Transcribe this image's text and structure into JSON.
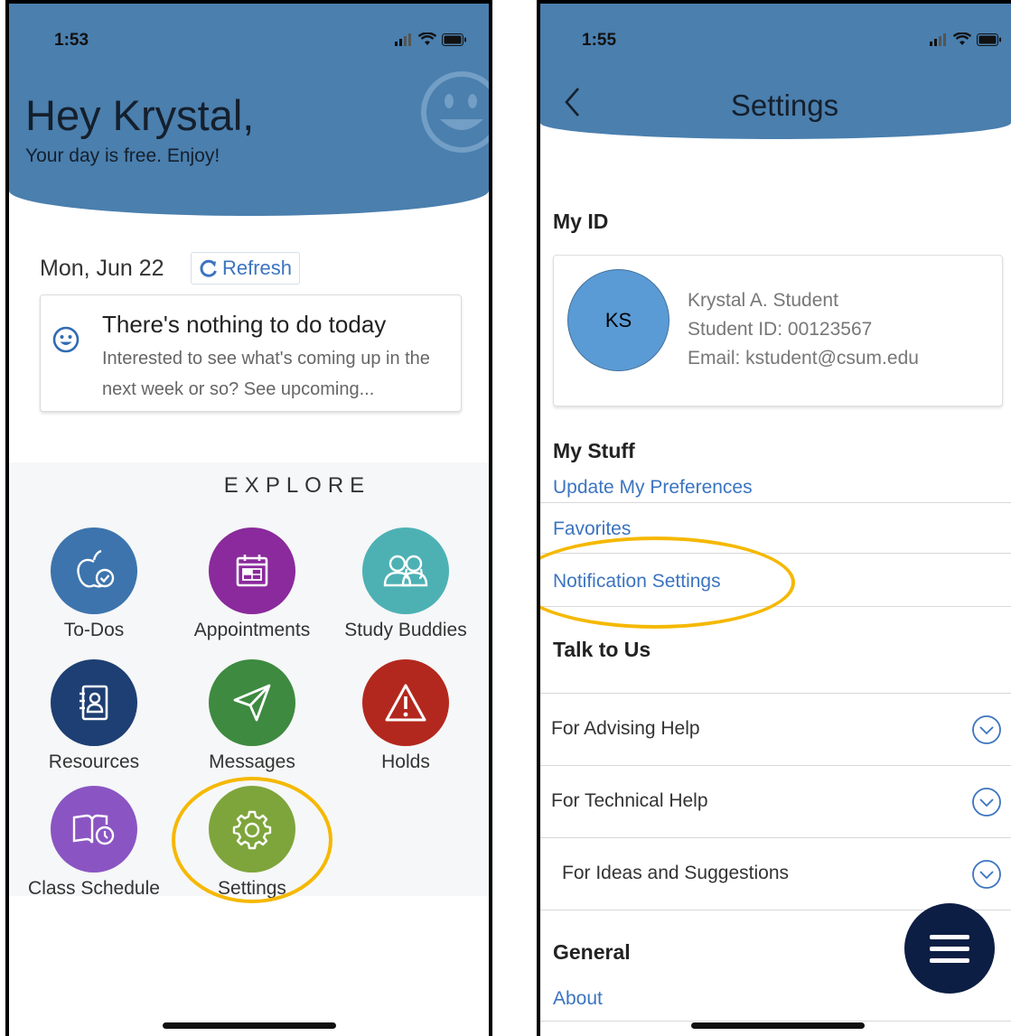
{
  "colors": {
    "header": "#4a7fae",
    "link": "#3b74c0",
    "highlight": "#f5b800",
    "fab": "#0d1e44"
  },
  "home": {
    "time": "1:53",
    "greeting": "Hey Krystal,",
    "subtitle": "Your day is free. Enjoy!",
    "date": "Mon, Jun 22",
    "refresh_label": "Refresh",
    "empty_title": "There's nothing to do today",
    "empty_body": "Interested to see what's coming up in the next week or so? See upcoming...",
    "explore_label": "EXPLORE",
    "tiles": [
      {
        "label": "To-Dos",
        "color": "#3d74ad",
        "icon": "apple-check-icon"
      },
      {
        "label": "Appointments",
        "color": "#8a2a9c",
        "icon": "calendar-icon"
      },
      {
        "label": "Study Buddies",
        "color": "#4db1b4",
        "icon": "people-icon"
      },
      {
        "label": "Resources",
        "color": "#1d3f73",
        "icon": "address-book-icon"
      },
      {
        "label": "Messages",
        "color": "#3e8a40",
        "icon": "paper-plane-icon"
      },
      {
        "label": "Holds",
        "color": "#b3281e",
        "icon": "warning-icon"
      },
      {
        "label": "Class Schedule",
        "color": "#8a55c3",
        "icon": "book-clock-icon"
      },
      {
        "label": "Settings",
        "color": "#7ea53b",
        "icon": "gear-icon"
      }
    ]
  },
  "settings": {
    "time": "1:55",
    "title": "Settings",
    "my_id_heading": "My ID",
    "avatar_initials": "KS",
    "name": "Krystal A. Student",
    "student_id": "Student ID: 00123567",
    "email": "Email: kstudent@csum.edu",
    "my_stuff_heading": "My Stuff",
    "my_stuff_links": [
      "Update My Preferences",
      "Favorites",
      "Notification Settings"
    ],
    "talk_heading": "Talk to Us",
    "talk_items": [
      "For Advising Help",
      "For Technical Help",
      "For Ideas and Suggestions"
    ],
    "general_heading": "General",
    "general_links": [
      "About"
    ]
  }
}
